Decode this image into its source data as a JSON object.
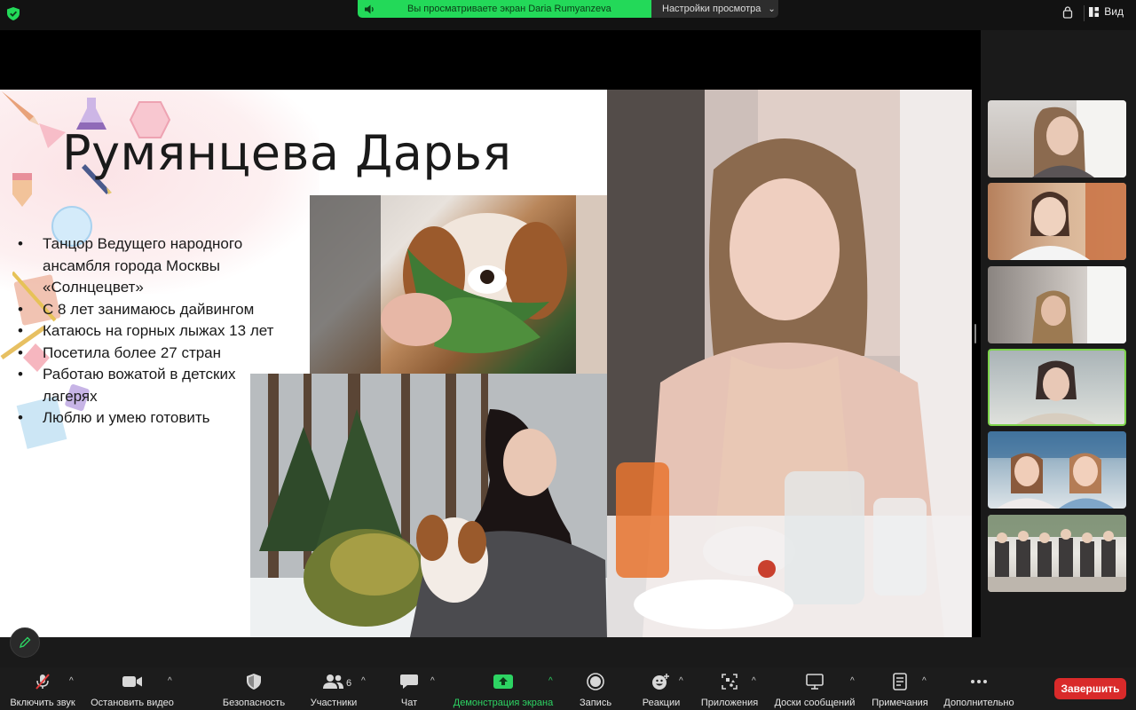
{
  "topbar": {
    "sharing_label": "Вы просматриваете экран Daria Rumyanzeva",
    "view_settings_label": "Настройки просмотра",
    "view_button_label": "Вид"
  },
  "slide": {
    "title": "Румянцева Дарья",
    "bullets": [
      "Танцор Ведущего народного ансамбля города Москвы «Солнцецвет»",
      "С 8 лет занимаюсь дайвингом",
      "Катаюсь на горных лыжах 13 лет",
      "Посетила более 27 стран",
      "Работаю вожатой в детских лагерях",
      "Люблю и умею готовить"
    ]
  },
  "gallery": {
    "tiles": [
      {
        "active": false
      },
      {
        "active": false
      },
      {
        "active": false
      },
      {
        "active": true
      },
      {
        "active": false
      },
      {
        "active": false
      }
    ]
  },
  "toolbar": {
    "unmute": "Включить звук",
    "stop_video": "Остановить видео",
    "security": "Безопасность",
    "participants": "Участники",
    "participants_count": "6",
    "chat": "Чат",
    "share_screen": "Демонстрация экрана",
    "record": "Запись",
    "reactions": "Реакции",
    "apps": "Приложения",
    "whiteboards": "Доски сообщений",
    "notes": "Примечания",
    "more": "Дополнительно",
    "end": "Завершить"
  },
  "colors": {
    "share_green": "#23d959",
    "end_red": "#d92a2a",
    "active_tile_border": "#7cd34a"
  }
}
